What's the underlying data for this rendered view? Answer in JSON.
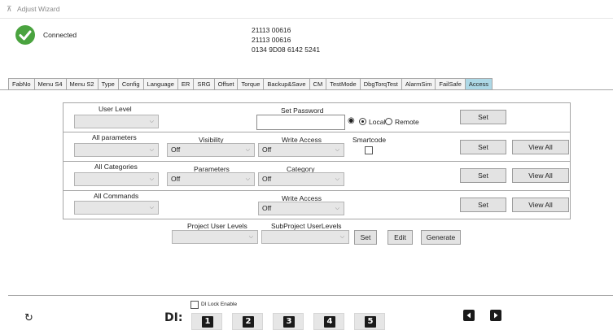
{
  "window": {
    "title": "Adjust Wizard"
  },
  "status": {
    "connected_label": "Connected",
    "serials": [
      "21113 00616",
      "21113 00616",
      "0134 9D08 6142 5241"
    ]
  },
  "tabs": [
    "FabNo",
    "Menu S4",
    "Menu S2",
    "Type",
    "Config",
    "Language",
    "ER",
    "SRG",
    "Offset",
    "Torque",
    "Backup&Save",
    "CM",
    "TestMode",
    "DbgTorqTest",
    "AlarmSim",
    "FailSafe",
    "Access"
  ],
  "active_tab": "Access",
  "user_level": {
    "label": "User Level",
    "value": ""
  },
  "password": {
    "label": "Set Password",
    "value": "",
    "local_label": "Local",
    "remote_label": "Remote",
    "selected": "Local",
    "set_label": "Set"
  },
  "parameters_row": {
    "all_label": "All parameters",
    "all_value": "",
    "visibility_label": "Visibility",
    "visibility_value": "Off",
    "write_label": "Write Access",
    "write_value": "Off",
    "smartcode_label": "Smartcode",
    "set_label": "Set",
    "view_label": "View All"
  },
  "categories_row": {
    "all_label": "All Categories",
    "all_value": "",
    "parameters_label": "Parameters",
    "parameters_value": "Off",
    "category_label": "Category",
    "category_value": "Off",
    "set_label": "Set",
    "view_label": "View All"
  },
  "commands_row": {
    "all_label": "All Commands",
    "all_value": "",
    "write_label": "Write Access",
    "write_value": "Off",
    "set_label": "Set",
    "view_label": "View All"
  },
  "project": {
    "project_label": "Project User Levels",
    "project_value": "",
    "subproject_label": "SubProject UserLevels",
    "subproject_value": "",
    "set_label": "Set",
    "edit_label": "Edit",
    "generate_label": "Generate"
  },
  "footer": {
    "di_lock_label": "DI Lock Enable",
    "di_label": "DI:",
    "di_buttons": [
      "1",
      "2",
      "3",
      "4",
      "5"
    ]
  }
}
